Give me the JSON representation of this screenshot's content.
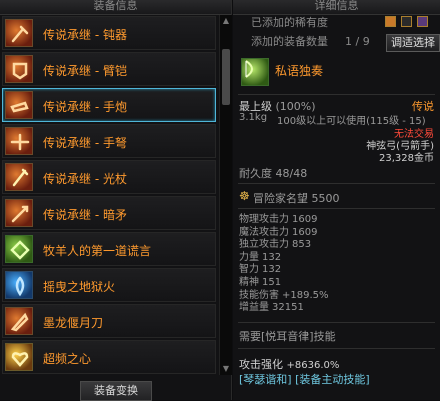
{
  "left": {
    "header": "装备信息",
    "items": [
      {
        "name": "传说承继 - 钝器",
        "icon": "blunt-weapon-icon"
      },
      {
        "name": "传说承继 - 臂铠",
        "icon": "arm-guard-icon"
      },
      {
        "name": "传说承继 - 手炮",
        "icon": "hand-cannon-icon"
      },
      {
        "name": "传说承继 - 手弩",
        "icon": "hand-crossbow-icon"
      },
      {
        "name": "传说承继 - 光杖",
        "icon": "light-staff-icon"
      },
      {
        "name": "传说承继 - 暗矛",
        "icon": "dark-spear-icon"
      },
      {
        "name": "牧羊人的第一道谎言",
        "icon": "shepherd-lie-icon"
      },
      {
        "name": "摇曳之地狱火",
        "icon": "hellfire-icon"
      },
      {
        "name": "墨龙偃月刀",
        "icon": "ink-dragon-blade-icon"
      },
      {
        "name": "超频之心",
        "icon": "overclock-heart-icon"
      }
    ],
    "selected_index": 2,
    "swap_button": "装备变换"
  },
  "right": {
    "header": "详细信息",
    "added_label": "已添加的稀有度",
    "added_count_label": "添加的装备数量",
    "added_count": "1 / 9",
    "adjust_button": "调适选择",
    "item_name": "私语独奏",
    "grade": "最上级",
    "grade_pct": "(100%)",
    "rarity": "传说",
    "weight": "3.1kg",
    "level_req": "100级以上可以使用(115级 - 15)",
    "trade": "无法交易",
    "item_type": "神弦弓(弓箭手)",
    "price": "23,328金币",
    "durability_label": "耐久度",
    "durability": "48/48",
    "fame_label": "冒险家名望",
    "fame": "5500",
    "stats": [
      {
        "label": "物理攻击力",
        "value": "1609"
      },
      {
        "label": "魔法攻击力",
        "value": "1609"
      },
      {
        "label": "独立攻击力",
        "value": "853"
      },
      {
        "label": "力量",
        "value": "132"
      },
      {
        "label": "智力",
        "value": "132"
      },
      {
        "label": "精神",
        "value": "151"
      },
      {
        "label": "技能伤害",
        "value": "+189.5%"
      },
      {
        "label": "增益量",
        "value": "32151"
      }
    ],
    "skill_req": "需要[悦耳音律]技能",
    "atk_enhance_label": "攻击强化",
    "atk_enhance": "+8636.0%",
    "active_skill": "[琴瑟谐和] [装备主动技能]"
  },
  "colors": {
    "legendary": "#ff9a2e",
    "selected_border": "#4fb6d8",
    "warning": "#ff4a3a"
  }
}
